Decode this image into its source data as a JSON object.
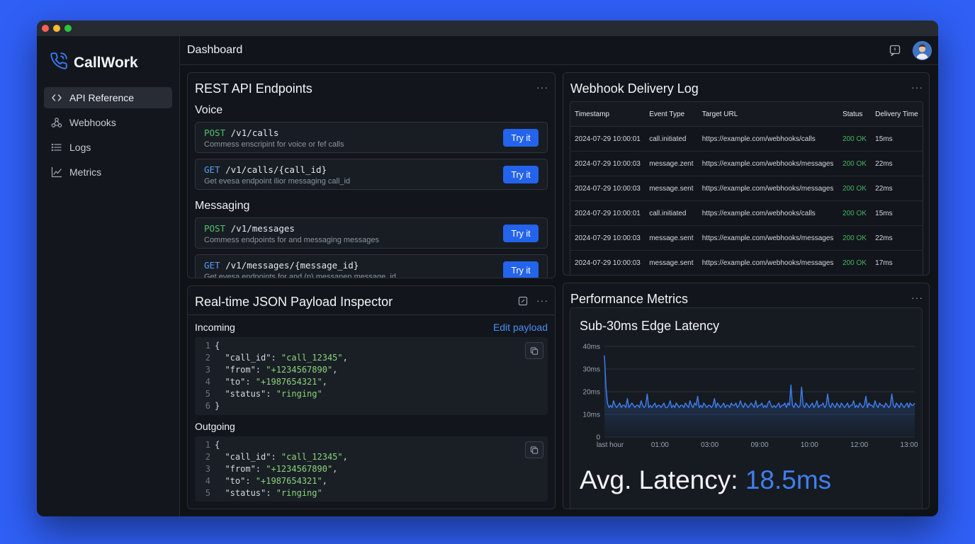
{
  "app": {
    "name": "CallWork"
  },
  "sidebar": {
    "items": [
      {
        "label": "API Reference",
        "icon": "code-icon",
        "active": true
      },
      {
        "label": "Webhooks",
        "icon": "webhook-icon",
        "active": false
      },
      {
        "label": "Logs",
        "icon": "list-icon",
        "active": false
      },
      {
        "label": "Metrics",
        "icon": "chart-line-icon",
        "active": false
      }
    ]
  },
  "header": {
    "title": "Dashboard"
  },
  "endpoints_panel": {
    "title": "REST API Endpoints",
    "voice_title": "Voice",
    "messaging_title": "Messaging",
    "voice": [
      {
        "method": "POST",
        "path": "/v1/calls",
        "description": "Commess enscripint for voice or fef calls",
        "button": "Try it"
      },
      {
        "method": "GET",
        "path": "/v1/calls/{call_id}",
        "description": "Get evesa endpoint ilior messaging call_id",
        "button": "Try it"
      }
    ],
    "messaging": [
      {
        "method": "POST",
        "path": "/v1/messages",
        "description": "Commess endpoints for and messaging messages",
        "button": "Try it"
      },
      {
        "method": "GET",
        "path": "/v1/messages/{message_id}",
        "description": "Get evesa endpoints for and (p) messanen message_id",
        "button": "Try it"
      }
    ]
  },
  "webhook_panel": {
    "title": "Webhook Delivery Log",
    "columns": [
      "Timestamp",
      "Event Type",
      "Target URL",
      "Status",
      "Delivery Time"
    ],
    "rows": [
      [
        "2024-07-29 10:00:01",
        "call.initiated",
        "https://example.com/webhooks/calls",
        "200 OK",
        "15ms"
      ],
      [
        "2024-07-29 10:00:03",
        "message.zent",
        "https://example.com/webhooks/messages",
        "200 OK",
        "22ms"
      ],
      [
        "2024-07-29 10:00:03",
        "message.sent",
        "https://example.com/webhooks/messages",
        "200 OK",
        "22ms"
      ],
      [
        "2024-07-29 10:00:01",
        "call.initiated",
        "https://example.com/webhooks/calls",
        "200 OK",
        "15ms"
      ],
      [
        "2024-07-29 10:00:03",
        "message.sent",
        "https://example.com/webhooks/messages",
        "200 OK",
        "22ms"
      ],
      [
        "2024-07-29 10:00:03",
        "message.sent",
        "https://example.com/webhooks/messages",
        "200 OK",
        "17ms"
      ]
    ]
  },
  "inspector_panel": {
    "title": "Real-time JSON Payload Inspector",
    "incoming_label": "Incoming",
    "outgoing_label": "Outgoing",
    "edit_link": "Edit payload",
    "incoming": [
      {
        "n": "1",
        "text": "{"
      },
      {
        "n": "2",
        "key": "\"call_id\"",
        "value": "\"call_12345\"",
        "end": ","
      },
      {
        "n": "3",
        "key": "\"from\"",
        "value": "\"+1234567890\"",
        "end": ","
      },
      {
        "n": "4",
        "key": "\"to\"",
        "value": "\"+1987654321\"",
        "end": ","
      },
      {
        "n": "5",
        "key": "\"status\"",
        "value": "\"ringing\"",
        "end": ""
      },
      {
        "n": "6",
        "text": "}"
      }
    ],
    "outgoing": [
      {
        "n": "1",
        "text": "{"
      },
      {
        "n": "2",
        "key": "\"call_id\"",
        "value": "\"call_12345\"",
        "end": ","
      },
      {
        "n": "3",
        "key": "\"from\"",
        "value": "\"+1234567890\"",
        "end": ","
      },
      {
        "n": "4",
        "key": "\"to\"",
        "value": "\"+1987654321\"",
        "end": ","
      },
      {
        "n": "5",
        "key": "\"status\"",
        "value": "\"ringing\"",
        "end": ""
      }
    ]
  },
  "metrics_panel": {
    "title": "Performance Metrics",
    "avg_label": "Avg. Latency: ",
    "avg_value": "18.5ms"
  },
  "colors": {
    "accent": "#2463eb",
    "post_method": "#4ec36a",
    "get_method": "#5b9cf0",
    "status_ok": "#47b562",
    "chart_line": "#3f7ff0",
    "background": "#2f5ff5"
  },
  "chart_data": {
    "type": "area",
    "title": "Sub-30ms Edge Latency",
    "xlabel": "",
    "ylabel": "",
    "ylim": [
      0,
      40
    ],
    "y_ticks": [
      "0",
      "10ms",
      "20ms",
      "30ms",
      "40ms"
    ],
    "x_ticks": [
      "last hour",
      "01:00",
      "03:00",
      "09:00",
      "10:00",
      "12:00",
      "13:00"
    ],
    "grid": true,
    "series": [
      {
        "values": [
          36,
          22,
          15,
          13,
          14,
          13,
          16,
          14,
          13,
          14,
          15,
          13,
          14,
          14,
          13,
          17,
          13,
          14,
          15,
          14,
          13,
          14,
          14,
          13,
          16,
          14,
          13,
          14,
          19,
          13,
          14,
          13,
          14,
          15,
          13,
          14,
          14,
          13,
          14,
          15,
          13,
          13,
          14,
          16,
          13,
          14,
          13,
          15,
          14,
          13,
          14,
          14,
          13,
          15,
          14,
          13,
          16,
          14,
          13,
          15,
          14,
          18,
          13,
          14,
          13,
          15,
          14,
          13,
          14,
          14,
          13,
          14,
          17,
          13,
          15,
          14,
          13,
          14,
          15,
          13,
          14,
          14,
          13,
          15,
          14,
          14,
          15,
          13,
          14,
          16,
          14,
          13,
          15,
          14,
          13,
          14,
          15,
          14,
          13,
          16,
          13,
          14,
          14,
          15,
          13,
          14,
          13,
          15,
          16,
          14,
          13,
          14,
          13,
          14,
          15,
          13,
          14,
          14,
          15,
          13,
          15,
          14,
          23,
          14,
          13,
          15,
          14,
          13,
          14,
          22,
          14,
          13,
          15,
          14,
          13,
          14,
          15,
          13,
          14,
          16,
          13,
          14,
          14,
          15,
          13,
          14,
          19,
          14,
          13,
          15,
          14,
          13,
          15,
          14,
          13,
          15,
          14,
          13,
          14,
          15,
          13,
          14,
          14,
          16,
          13,
          14,
          13,
          15,
          14,
          13,
          14,
          18,
          13,
          15,
          14,
          14,
          13,
          16,
          14,
          13,
          15,
          14,
          14,
          13,
          15,
          14,
          13,
          14,
          19,
          14,
          13,
          15,
          14,
          13,
          15,
          14,
          13,
          14,
          15,
          13,
          15,
          14,
          14,
          15
        ]
      }
    ]
  }
}
